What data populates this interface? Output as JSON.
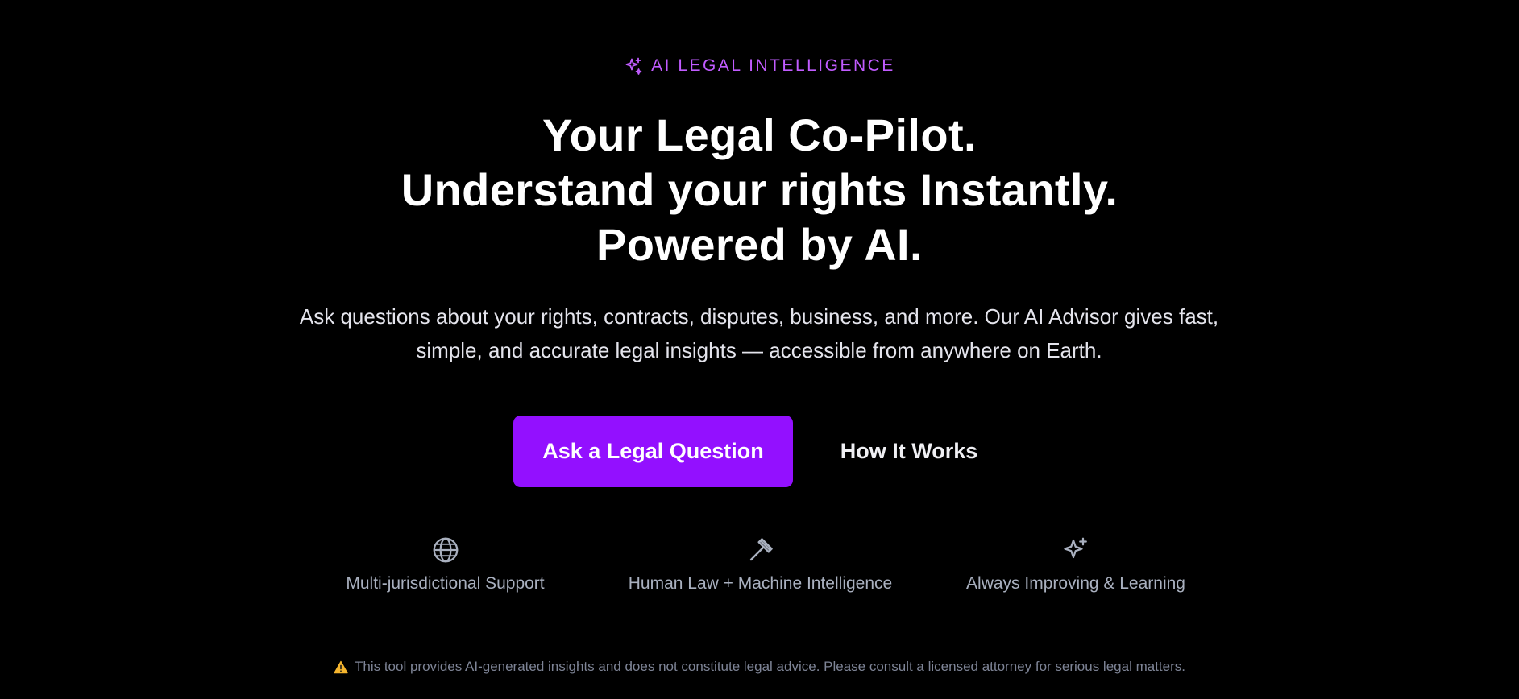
{
  "eyebrow": {
    "icon": "sparkles-icon",
    "text": "AI LEGAL INTELLIGENCE",
    "color": "#c15cff"
  },
  "headline": {
    "line1": "Your Legal Co-Pilot.",
    "line2": "Understand your rights Instantly.",
    "line3": "Powered by AI."
  },
  "subtext": "Ask questions about your rights, contracts, disputes, business, and more. Our AI Advisor gives fast, simple, and accurate legal insights — accessible from anywhere on Earth.",
  "actions": {
    "primary_label": "Ask a Legal Question",
    "primary_color": "#9310ff",
    "secondary_label": "How It Works"
  },
  "features": [
    {
      "icon": "globe-icon",
      "label": "Multi-jurisdictional Support"
    },
    {
      "icon": "gavel-icon",
      "label": "Human Law + Machine Intelligence"
    },
    {
      "icon": "sparkles-icon",
      "label": "Always Improving & Learning"
    }
  ],
  "disclaimer": {
    "icon": "warning-icon",
    "text": "This tool provides AI-generated insights and does not constitute legal advice. Please consult a licensed attorney for serious legal matters."
  }
}
